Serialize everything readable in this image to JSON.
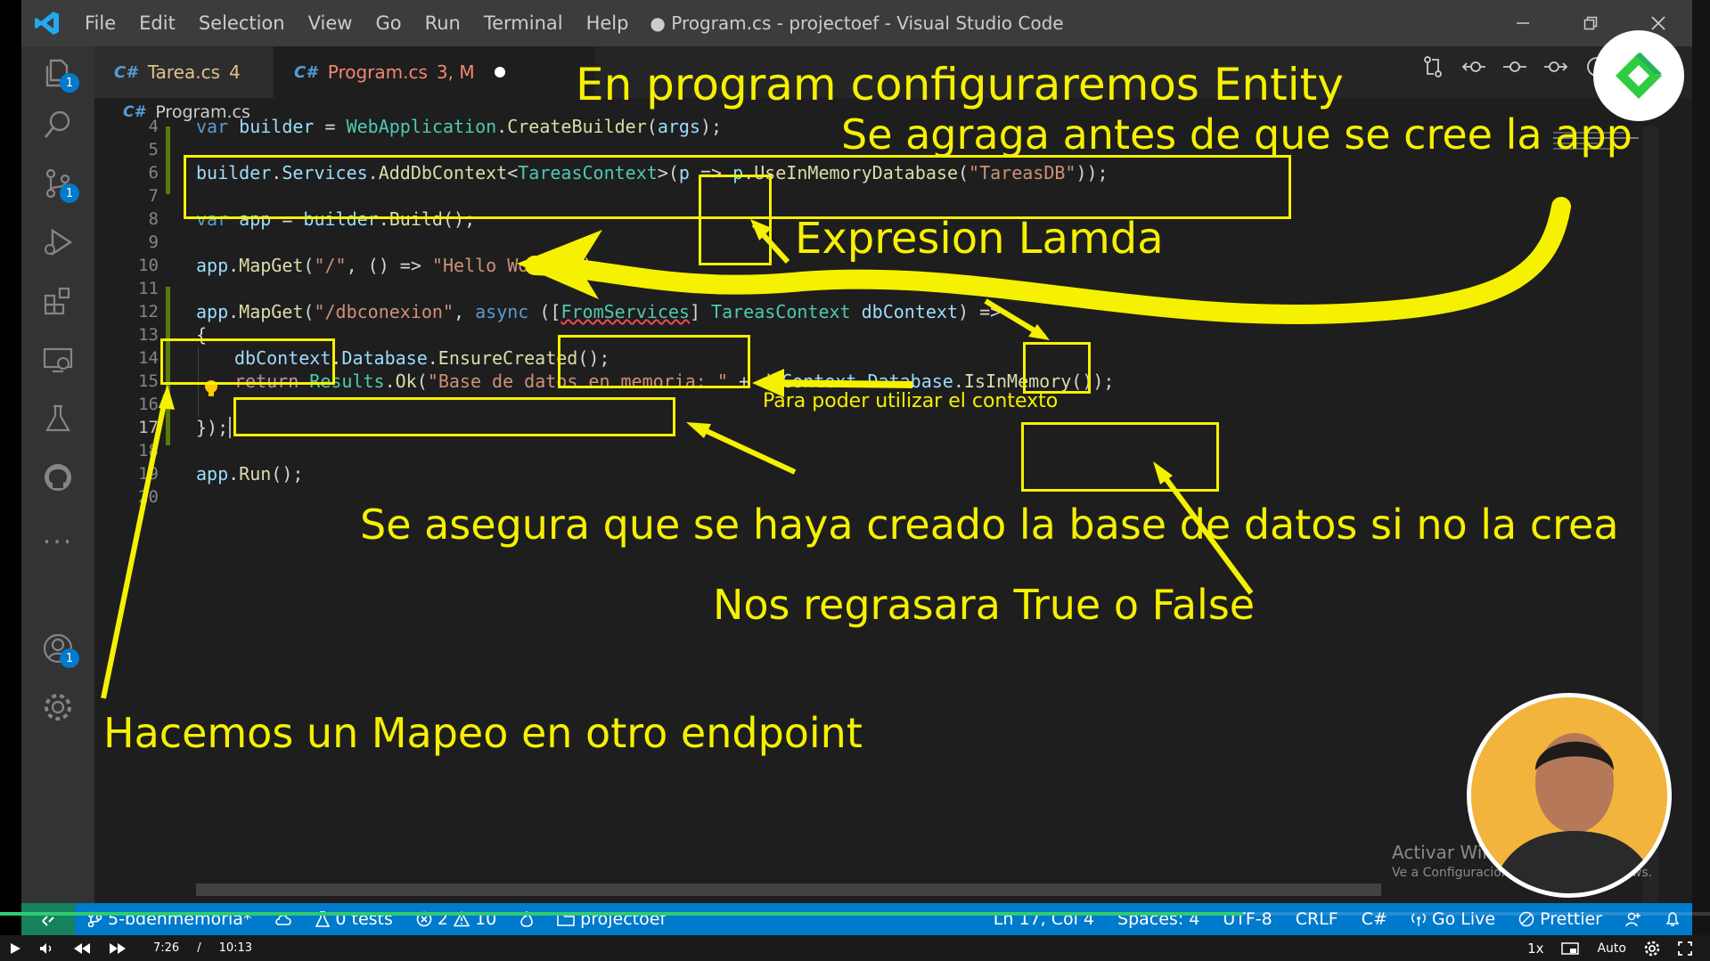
{
  "window": {
    "title": "● Program.cs - projectoef - Visual Studio Code",
    "menu": [
      "File",
      "Edit",
      "Selection",
      "View",
      "Go",
      "Run",
      "Terminal",
      "Help"
    ]
  },
  "activity_bar": {
    "items": [
      {
        "name": "explorer",
        "badge": "1"
      },
      {
        "name": "search",
        "badge": ""
      },
      {
        "name": "source-control",
        "badge": "1"
      },
      {
        "name": "run-debug",
        "badge": ""
      },
      {
        "name": "extensions",
        "badge": ""
      },
      {
        "name": "remote-explorer",
        "badge": ""
      },
      {
        "name": "testing",
        "badge": ""
      },
      {
        "name": "github",
        "badge": ""
      }
    ],
    "more": "...",
    "accounts_badge": "1"
  },
  "tabs": [
    {
      "icon": "C#",
      "label": "Tarea.cs",
      "count": "4",
      "active": false
    },
    {
      "icon": "C#",
      "label": "Program.cs",
      "count": "3, M",
      "active": true,
      "modified": true
    }
  ],
  "breadcrumb": {
    "icon": "C#",
    "file": "Program.cs"
  },
  "editor": {
    "line_numbers": [
      "4",
      "5",
      "6",
      "7",
      "8",
      "9",
      "10",
      "11",
      "12",
      "13",
      "14",
      "15",
      "16",
      "17",
      "18",
      "19",
      "20"
    ],
    "current_line": "17",
    "lines": {
      "l4": {
        "a": "var ",
        "b": "builder",
        "c": " = ",
        "d": "WebApplication",
        "e": ".",
        "f": "CreateBuilder",
        "g": "(",
        "h": "args",
        "i": ");"
      },
      "l6": {
        "a": "builder",
        "b": ".",
        "c": "Services",
        "d": ".",
        "e": "AddDbContext",
        "f": "<",
        "g": "TareasContext",
        "h": ">(",
        "i": "p",
        "j": " => ",
        "k": "p",
        "l": ".",
        "m": "UseInMemoryDatabase",
        "n": "(",
        "o": "\"TareasDB\"",
        "p": "));"
      },
      "l8": {
        "a": "var ",
        "b": "app",
        "c": " = ",
        "d": "builder",
        "e": ".",
        "f": "Build",
        "g": "();"
      },
      "l10": {
        "a": "app",
        "b": ".",
        "c": "MapGet",
        "d": "(",
        "e": "\"/\"",
        "f": ", () => ",
        "g": "\"Hello World!\"",
        "h": ");"
      },
      "l12": {
        "a": "app",
        "b": ".",
        "c": "MapGet",
        "d": "(",
        "e": "\"/dbconexion\"",
        "f": ", ",
        "g": "async",
        "h": " ([",
        "i": "FromServices",
        "j": "] ",
        "k": "TareasContext",
        "l": " ",
        "m": "dbContext",
        "n": ") =>"
      },
      "l13": {
        "a": "{"
      },
      "l14": {
        "a": "dbContext",
        "b": ".",
        "c": "Database",
        "d": ".",
        "e": "EnsureCreated",
        "f": "();"
      },
      "l15": {
        "a": "return ",
        "b": "Results",
        "c": ".",
        "d": "Ok",
        "e": "(",
        "f": "\"Base de datos en memoria: \"",
        "g": " + ",
        "h": "dbContext",
        "i": ".",
        "j": "Database",
        "k": ".",
        "l": "IsInMemory",
        "m": "());"
      },
      "l17": {
        "a": "});"
      },
      "l19": {
        "a": "app",
        "b": ".",
        "c": "Run",
        "d": "();"
      }
    }
  },
  "annotations": {
    "a1": "En program configuraremos Entity",
    "a2": "Se agraga antes de que se cree la app",
    "a3": "Expresion Lamda",
    "a4": "Para poder utilizar el contexto",
    "a5": "Se asegura que se haya creado la base de datos si no la crea",
    "a6": "Nos regrasara True o False",
    "a7": "Hacemos un Mapeo en otro endpoint"
  },
  "watermark": {
    "line1": "Activar Windows",
    "line2": "Ve a Configuración para activar Windows."
  },
  "statusbar": {
    "branch": "5-bdenmemoria*",
    "tests": "0 tests",
    "errors": "2",
    "warnings": "10",
    "folder": "projectoef",
    "position": "Ln 17, Col 4",
    "spaces": "Spaces: 4",
    "encoding": "UTF-8",
    "eol": "CRLF",
    "language": "C#",
    "golive": "Go Live",
    "prettier": "Prettier"
  },
  "player": {
    "current": "7:26",
    "sep": "/",
    "duration": "10:13",
    "speed": "1x",
    "quality": "Auto",
    "progress": 0.727
  },
  "colors": {
    "annotation": "#f5f100",
    "statusbar": "#007acc",
    "titlebar": "#3c3c3c"
  }
}
